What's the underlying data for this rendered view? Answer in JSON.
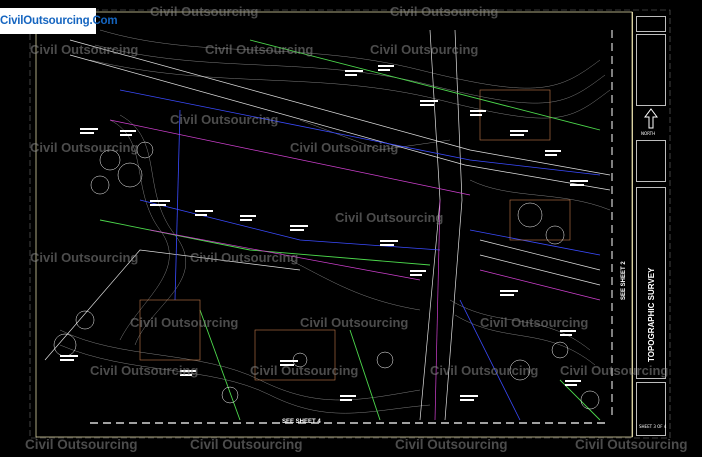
{
  "watermark": {
    "logo_text": "CivilOutsourcing.Com",
    "text": "Civil Outsourcing"
  },
  "sheet": {
    "title": "TOPOGRAPHIC SURVEY",
    "see_sheet_bottom": "SEE SHEET 4",
    "see_sheet_right": "SEE SHEET 2",
    "north_label": "NORTH",
    "sheet_number": "SHEET 3 OF 4"
  },
  "colors": {
    "background": "#000000",
    "border": "#d8d0a0",
    "road": "#ffffff",
    "utility_blue": "#3a4bff",
    "utility_green": "#4cd84c",
    "utility_magenta": "#d040d0",
    "contour_gray": "#9a9a9a",
    "watermark": "#8a8a8a"
  }
}
